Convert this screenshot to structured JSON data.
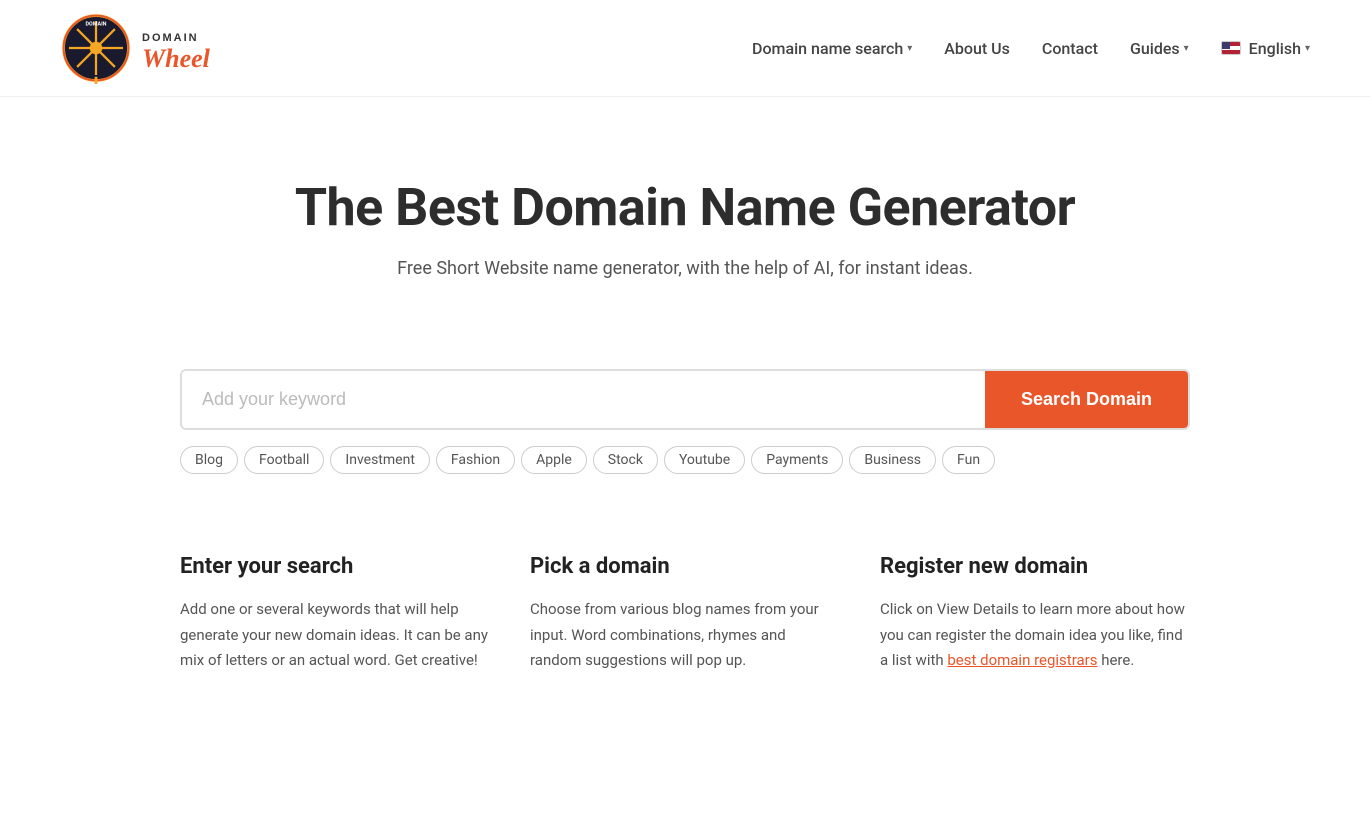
{
  "header": {
    "logo_alt": "Domain Wheel",
    "nav": {
      "domain_search_label": "Domain name search",
      "about_label": "About Us",
      "contact_label": "Contact",
      "guides_label": "Guides",
      "english_label": "English"
    }
  },
  "hero": {
    "title": "The Best Domain Name Generator",
    "subtitle": "Free Short Website name generator, with the help of AI, for instant ideas."
  },
  "search": {
    "placeholder": "Add your keyword",
    "button_label": "Search Domain",
    "tags": [
      "Blog",
      "Football",
      "Investment",
      "Fashion",
      "Apple",
      "Stock",
      "Youtube",
      "Payments",
      "Business",
      "Fun"
    ]
  },
  "info_cards": [
    {
      "id": "enter-search",
      "title": "Enter your search",
      "body": "Add one or several keywords that will help generate your new domain ideas. It can be any mix of letters or an actual word. Get creative!"
    },
    {
      "id": "pick-domain",
      "title": "Pick a domain",
      "body": "Choose from various blog names from your input. Word combinations, rhymes and random suggestions will pop up."
    },
    {
      "id": "register-domain",
      "title": "Register new domain",
      "body_pre": "Click on View Details to learn more about how you can register the domain idea you like, find a list with ",
      "link_label": "best domain registrars",
      "body_post": " here."
    }
  ]
}
